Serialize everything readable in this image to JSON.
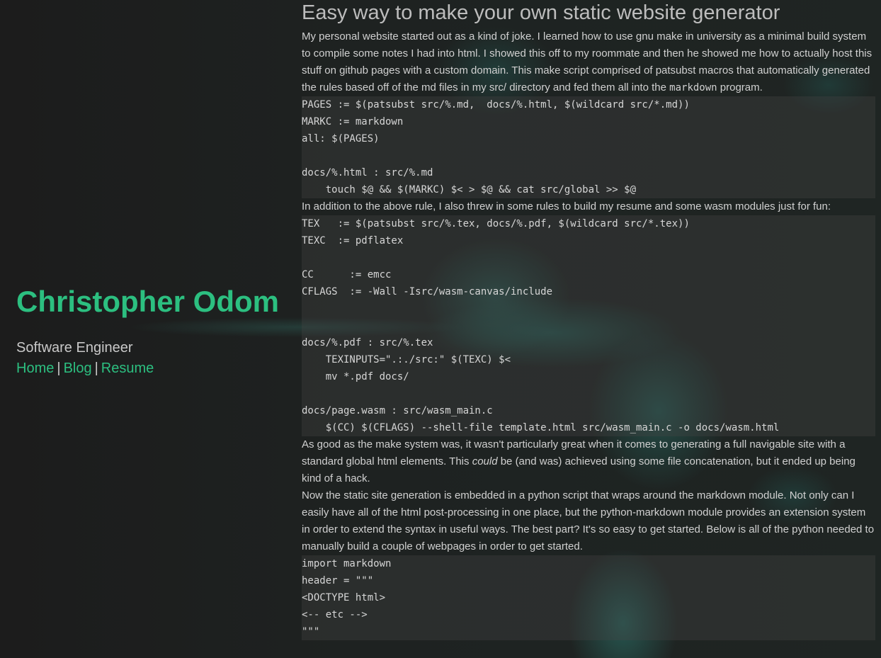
{
  "sidebar": {
    "name": "Christopher Odom",
    "role": "Software Engineer",
    "nav": [
      {
        "label": "Home"
      },
      {
        "label": "Blog"
      },
      {
        "label": "Resume"
      }
    ],
    "separator": "|"
  },
  "post": {
    "title": "Easy way to make your own static website generator",
    "p1_before": "My personal website started out as a kind of joke. I learned how to use gnu make in university as a minimal build system to compile some notes I had into html. I showed this off to my roommate and then he showed me how to actually host this stuff on github pages with a custom domain. This make script comprised of patsubst macros that automatically generated the rules based off of the md files in my src/ directory and fed them all into the ",
    "p1_code": "markdown",
    "p1_after": " program.",
    "code1": "PAGES := $(patsubst src/%.md,  docs/%.html, $(wildcard src/*.md))\nMARKC := markdown\nall: $(PAGES)\n\ndocs/%.html : src/%.md\n    touch $@ && $(MARKC) $< > $@ && cat src/global >> $@",
    "p2": "In addition to the above rule, I also threw in some rules to build my resume and some wasm modules just for fun:",
    "code2": "TEX   := $(patsubst src/%.tex, docs/%.pdf, $(wildcard src/*.tex))\nTEXC  := pdflatex\n\nCC      := emcc\nCFLAGS  := -Wall -Isrc/wasm-canvas/include\n\n\ndocs/%.pdf : src/%.tex\n    TEXINPUTS=\".:./src:\" $(TEXC) $<\n    mv *.pdf docs/\n\ndocs/page.wasm : src/wasm_main.c\n    $(CC) $(CFLAGS) --shell-file template.html src/wasm_main.c -o docs/wasm.html",
    "p3_before": "As good as the make system was, it wasn't particularly great when it comes to generating a full navigable site with a standard global html elements. This ",
    "p3_em": "could",
    "p3_after": " be (and was) achieved using some file concatenation, but it ended up being kind of a hack.",
    "p4": "Now the static site generation is embedded in a python script that wraps around the markdown module. Not only can I easily have all of the html post-processing in one place, but the python-markdown module provides an extension system in order to extend the syntax in useful ways. The best part? It's so easy to get started. Below is all of the python needed to manually build a couple of webpages in order to get started.",
    "code3": "import markdown\nheader = \"\"\"\n<DOCTYPE html>\n<-- etc -->\n\"\"\""
  }
}
